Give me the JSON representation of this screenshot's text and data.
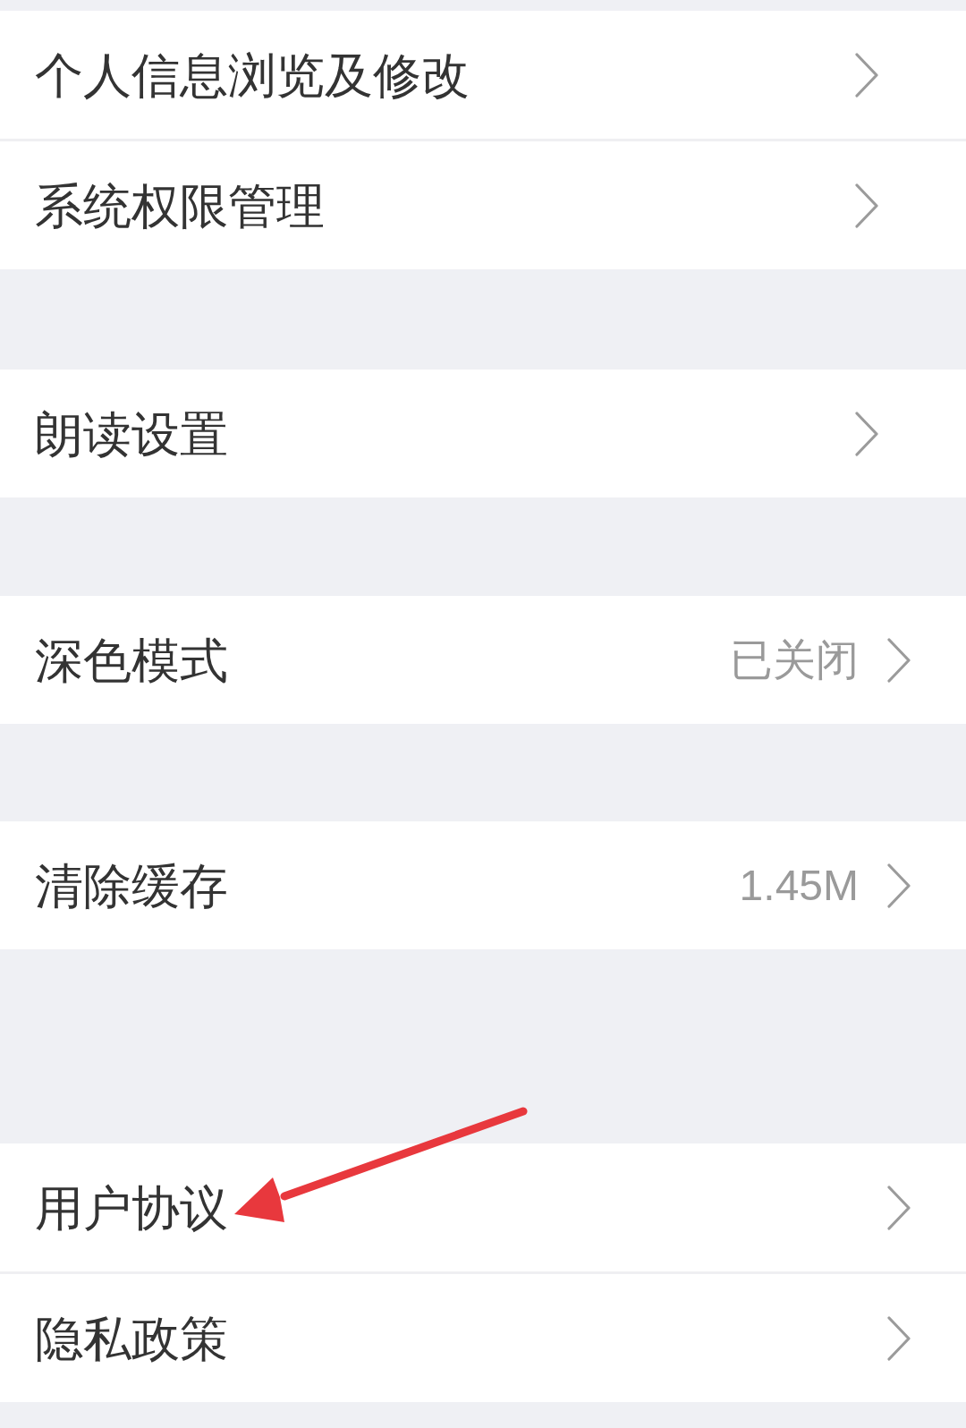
{
  "sections": [
    {
      "items": [
        {
          "label": "个人信息浏览及修改",
          "annotated": false
        },
        {
          "label": "系统权限管理",
          "annotated": false
        }
      ]
    },
    {
      "items": [
        {
          "label": "朗读设置",
          "annotated": false
        }
      ]
    },
    {
      "items": [
        {
          "label": "深色模式",
          "value": "已关闭",
          "annotated": false
        }
      ]
    },
    {
      "items": [
        {
          "label": "清除缓存",
          "value": "1.45M",
          "annotated": false
        }
      ]
    },
    {
      "items": [
        {
          "label": "用户协议",
          "annotated": true
        },
        {
          "label": "隐私政策",
          "annotated": false
        }
      ]
    }
  ]
}
